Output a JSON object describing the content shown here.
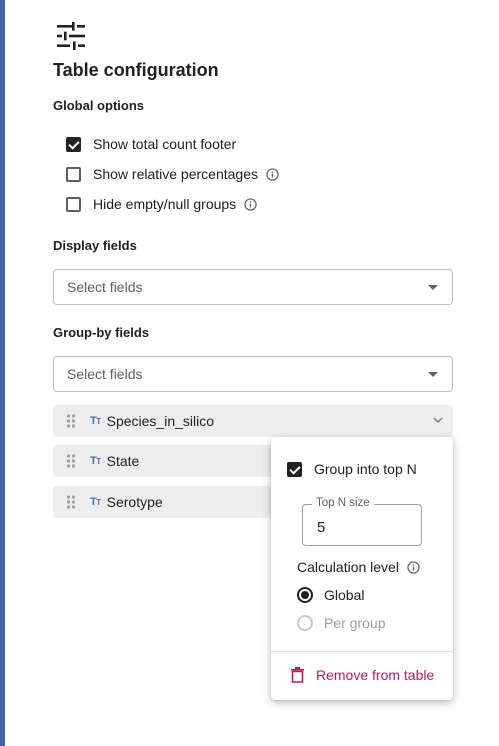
{
  "panel": {
    "title": "Table configuration",
    "global_options": {
      "label": "Global options",
      "items": [
        {
          "label": "Show total count footer",
          "checked": true,
          "info": false
        },
        {
          "label": "Show relative percentages",
          "checked": false,
          "info": true
        },
        {
          "label": "Hide empty/null groups",
          "checked": false,
          "info": true
        }
      ]
    },
    "display_fields": {
      "label": "Display fields",
      "placeholder": "Select fields"
    },
    "group_by_fields": {
      "label": "Group-by fields",
      "placeholder": "Select fields",
      "type_icon": "text-type-icon",
      "items": [
        {
          "name": "Species_in_silico",
          "expanded": true
        },
        {
          "name": "State"
        },
        {
          "name": "Serotype"
        }
      ]
    }
  },
  "popover": {
    "group_top_n_label": "Group into top N",
    "group_top_n_checked": true,
    "top_n_size_label": "Top N size",
    "top_n_size_value": "5",
    "calculation_level_label": "Calculation level",
    "calculation_options": [
      {
        "label": "Global",
        "selected": true,
        "enabled": true
      },
      {
        "label": "Per group",
        "selected": false,
        "enabled": false
      }
    ],
    "remove_label": "Remove from table"
  },
  "colors": {
    "accent_bar": "#4266ad",
    "type_icon": "#4a6fb0",
    "danger": "#c2185b"
  }
}
